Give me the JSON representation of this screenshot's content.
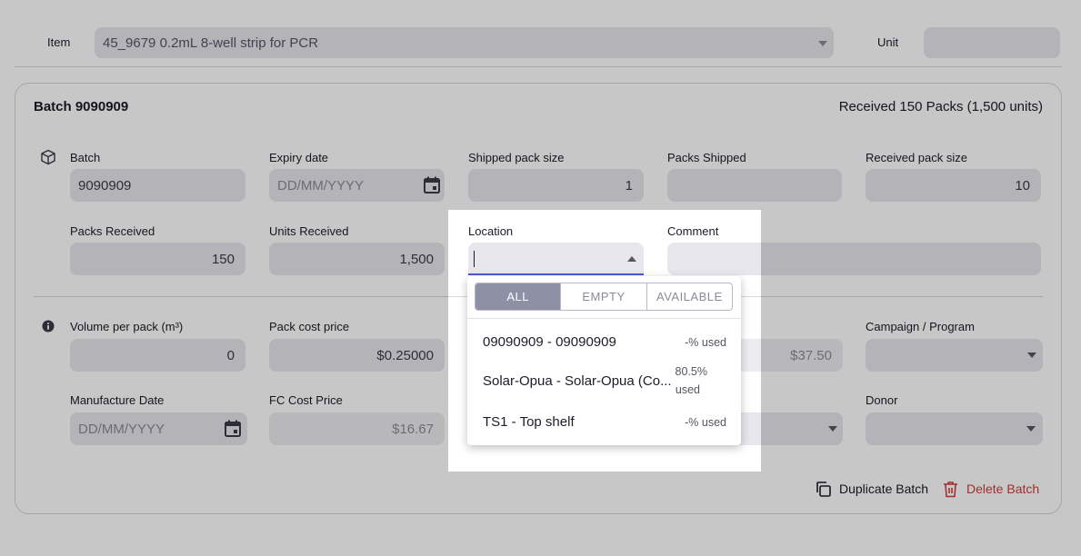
{
  "item_row": {
    "item_label": "Item",
    "item_value": "45_9679 0.2mL 8-well strip for PCR",
    "unit_label": "Unit",
    "unit_value": ""
  },
  "batch_card": {
    "title": "Batch 9090909",
    "received_summary": "Received 150 Packs (1,500 units)",
    "fields": {
      "batch": {
        "label": "Batch",
        "value": "9090909"
      },
      "expiry_date": {
        "label": "Expiry date",
        "placeholder": "DD/MM/YYYY"
      },
      "shipped_pack_size": {
        "label": "Shipped pack size",
        "value": "1"
      },
      "packs_shipped": {
        "label": "Packs Shipped",
        "value": ""
      },
      "received_pack_size": {
        "label": "Received pack size",
        "value": "10"
      },
      "packs_received": {
        "label": "Packs Received",
        "value": "150"
      },
      "units_received": {
        "label": "Units Received",
        "value": "1,500"
      },
      "location": {
        "label": "Location",
        "value": ""
      },
      "comment": {
        "label": "Comment",
        "value": ""
      },
      "volume_per_pack": {
        "label": "Volume per pack (m³)",
        "value": "0"
      },
      "pack_cost_price": {
        "label": "Pack cost price",
        "value": "$0.25000"
      },
      "line_total": {
        "value": "$37.50"
      },
      "campaign_program": {
        "label": "Campaign / Program",
        "value": ""
      },
      "manufacture_date": {
        "label": "Manufacture Date",
        "placeholder": "DD/MM/YYYY"
      },
      "fc_cost_price": {
        "label": "FC Cost Price",
        "value": "$16.67"
      },
      "donor": {
        "label": "Donor",
        "value": ""
      }
    },
    "actions": {
      "duplicate_label": "Duplicate Batch",
      "delete_label": "Delete Batch"
    }
  },
  "location_popup": {
    "tabs": [
      "ALL",
      "EMPTY",
      "AVAILABLE"
    ],
    "active_tab": "ALL",
    "options": [
      {
        "name": "09090909 - 09090909",
        "used_line1": "-% used",
        "used_line2": ""
      },
      {
        "name": "Solar-Opua - Solar-Opua (Co...",
        "used_line1": "80.5%",
        "used_line2": "used"
      },
      {
        "name": "TS1 - Top shelf",
        "used_line1": "-% used",
        "used_line2": ""
      }
    ]
  },
  "colors": {
    "accent_blue": "#4a5bd6",
    "delete_red": "#d33a3a",
    "active_tab": "#8e90a6"
  }
}
